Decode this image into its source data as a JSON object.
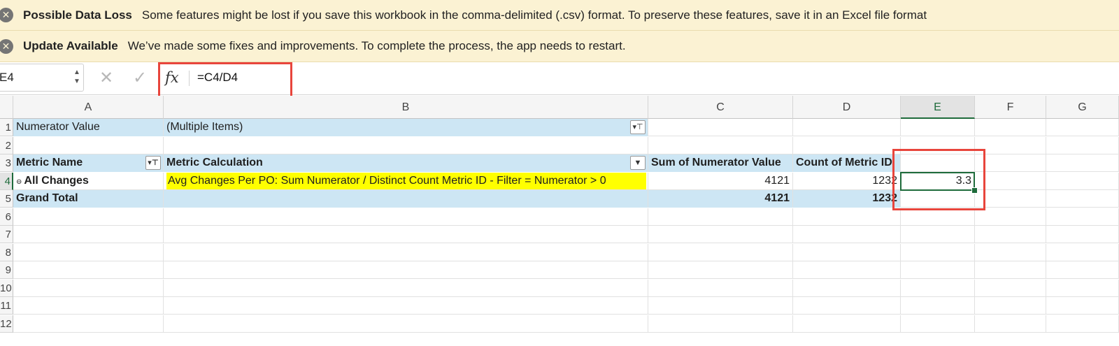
{
  "banners": {
    "data_loss": {
      "title": "Possible Data Loss",
      "message": "Some features might be lost if you save this workbook in the comma-delimited (.csv) format. To preserve these features, save it in an Excel file format"
    },
    "update": {
      "title": "Update Available",
      "message": "We’ve made some fixes and improvements. To complete the process, the app needs to restart."
    },
    "close_glyph": "✕"
  },
  "formula_bar": {
    "name_box": "E4",
    "stepper": "▲\n▼",
    "cancel_glyph": "✕",
    "enter_glyph": "✓",
    "fx_label": "fx",
    "formula": "=C4/D4"
  },
  "columns": [
    "A",
    "B",
    "C",
    "D",
    "E",
    "F",
    "G"
  ],
  "rows": [
    "1",
    "2",
    "3",
    "4",
    "5",
    "6",
    "7",
    "8",
    "9",
    "10",
    "11",
    "12"
  ],
  "sheet": {
    "r1": {
      "a": "Numerator Value",
      "b": "(Multiple Items)"
    },
    "r3": {
      "a": "Metric Name",
      "b": "Metric Calculation",
      "c": "Sum of Numerator Value",
      "d": "Count of Metric ID"
    },
    "r4": {
      "a": "All Changes",
      "b": "Avg Changes Per PO: Sum Numerator / Distinct Count Metric ID - Filter = Numerator > 0",
      "c": "4121",
      "d": "1232",
      "e": "3.3"
    },
    "r5": {
      "a": "Grand Total",
      "c": "4121",
      "d": "1232"
    }
  },
  "icons": {
    "filter": "▾⊤",
    "dropdown": "▼",
    "collapse": "⊖"
  },
  "colors": {
    "pivot_blue": "#cde6f4",
    "highlight_yellow": "#ffff00",
    "selection_green": "#1e6b3b",
    "annotation_red": "#e8453c",
    "banner_bg": "#fbf2d3"
  }
}
